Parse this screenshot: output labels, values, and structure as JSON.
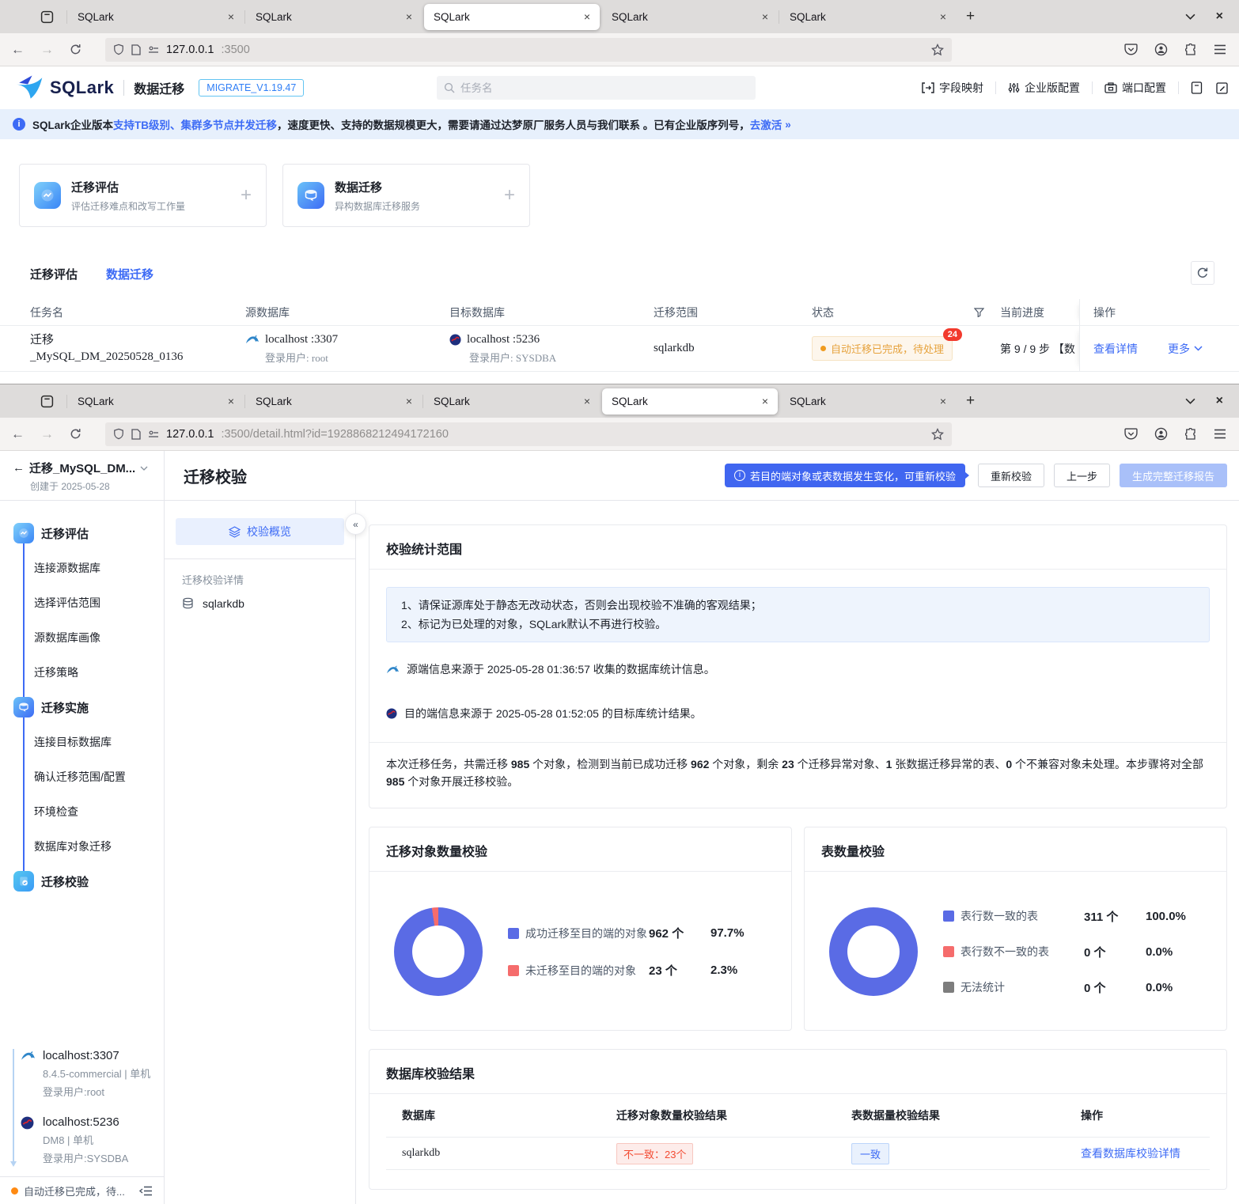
{
  "browser": {
    "tabs": [
      "SQLark",
      "SQLark",
      "SQLark",
      "SQLark",
      "SQLark"
    ],
    "window1": {
      "url_host": "127.0.0.1",
      "url_rest": ":3500"
    },
    "window2": {
      "url_host": "127.0.0.1",
      "url_rest": ":3500/detail.html?id=1928868212494172160"
    }
  },
  "app_header": {
    "brand": "SQLark",
    "product": "数据迁移",
    "version": "MIGRATE_V1.19.47",
    "search_placeholder": "任务名",
    "nav_field_mapping": "字段映射",
    "nav_enterprise": "企业版配置",
    "nav_port": "端口配置"
  },
  "banner": {
    "text_prefix": "SQLark企业版本",
    "link_capacity": "支持TB级别、集群多节点并发迁移",
    "text_middle": "，速度更快、支持的数据规模更大，需要请通过达梦原厂服务人员与我们联系 。已有企业版序列号，",
    "link_activate": "去激活",
    "arrow": "»"
  },
  "entry_cards": [
    {
      "title": "迁移评估",
      "desc": "评估迁移难点和改写工作量"
    },
    {
      "title": "数据迁移",
      "desc": "异构数据库迁移服务"
    }
  ],
  "task_list": {
    "tab_eval": "迁移评估",
    "tab_migrate": "数据迁移",
    "headers": {
      "name": "任务名",
      "source": "源数据库",
      "target": "目标数据库",
      "scope": "迁移范围",
      "status": "状态",
      "progress": "当前进度",
      "action": "操作"
    },
    "row": {
      "name_line1": "迁移",
      "name_line2": "_MySQL_DM_20250528_0136",
      "source_host": "localhost :3307",
      "source_user": "登录用户: root",
      "target_host": "localhost :5236",
      "target_user": "登录用户: SYSDBA",
      "scope": "sqlarkdb",
      "status": "自动迁移已完成，待处理",
      "status_count": "24",
      "progress": "第 9 / 9 步 【数",
      "action_view": "查看详情",
      "action_more": "更多"
    }
  },
  "detail": {
    "back_title": "迁移_MySQL_DM...",
    "created": "创建于 2025-05-28",
    "nav": {
      "eval": {
        "title": "迁移评估",
        "items": [
          "连接源数据库",
          "选择评估范围",
          "源数据库画像",
          "迁移策略"
        ]
      },
      "impl": {
        "title": "迁移实施",
        "items": [
          "连接目标数据库",
          "确认迁移范围/配置",
          "环境检查",
          "数据库对象迁移"
        ]
      },
      "verify": {
        "title": "迁移校验"
      }
    },
    "connections": [
      {
        "host": "localhost:3307",
        "meta": "8.4.5-commercial | 单机",
        "user": "登录用户:root"
      },
      {
        "host": "localhost:5236",
        "meta": "DM8 | 单机",
        "user": "登录用户:SYSDBA"
      }
    ],
    "status_bar": "自动迁移已完成，待...",
    "panel": {
      "overview": "校验概览",
      "detail_label": "迁移校验详情",
      "db": "sqlarkdb"
    },
    "page": {
      "title": "迁移校验",
      "tooltip": "若目的端对象或表数据发生变化，可重新校验",
      "btn_recheck": "重新校验",
      "btn_prev": "上一步",
      "btn_report": "生成完整迁移报告"
    },
    "scope": {
      "title": "校验统计范围",
      "notice1": "1、请保证源库处于静态无改动状态，否则会出现校验不准确的客观结果；",
      "notice2": "2、标记为已处理的对象，SQLark默认不再进行校验。",
      "source_info": "源端信息来源于 2025-05-28 01:36:57 收集的数据库统计信息。",
      "target_info": "目的端信息来源于 2025-05-28 01:52:05 的目标库统计结果。",
      "summary": {
        "p1": "本次迁移任务，共需迁移 ",
        "n1": "985",
        "p2": " 个对象，检测到当前已成功迁移 ",
        "n2": "962",
        "p3": " 个对象，剩余 ",
        "n3": "23",
        "p4": " 个迁移异常对象、",
        "n4": "1",
        "p5": " 张数据迁移异常的表、",
        "n5": "0",
        "p6": " 个不兼容对象未处理。本步骤将对全部 ",
        "n6": "985",
        "p7": " 个对象开展迁移校验。"
      }
    },
    "result": {
      "title": "数据库校验结果",
      "headers": [
        "数据库",
        "迁移对象数量校验结果",
        "表数据量校验结果",
        "操作"
      ],
      "row": {
        "db": "sqlarkdb",
        "object_result": "不一致：23个",
        "table_result": "一致",
        "action": "查看数据库校验详情"
      }
    }
  },
  "chart_data": [
    {
      "type": "pie",
      "title": "迁移对象数量校验",
      "legend_position": "right",
      "series": [
        {
          "name": "成功迁移至目的端的对象",
          "value": 962,
          "count_label": "962 个",
          "pct_label": "97.7%",
          "color": "#5A6BE5"
        },
        {
          "name": "未迁移至目的端的对象",
          "value": 23,
          "count_label": "23 个",
          "pct_label": "2.3%",
          "color": "#F56C6C"
        }
      ]
    },
    {
      "type": "pie",
      "title": "表数量校验",
      "legend_position": "right",
      "series": [
        {
          "name": "表行数一致的表",
          "value": 311,
          "count_label": "311 个",
          "pct_label": "100.0%",
          "color": "#5A6BE5"
        },
        {
          "name": "表行数不一致的表",
          "value": 0,
          "count_label": "0 个",
          "pct_label": "0.0%",
          "color": "#F56C6C"
        },
        {
          "name": "无法统计",
          "value": 0,
          "count_label": "0 个",
          "pct_label": "0.0%",
          "color": "#7D7D7D"
        }
      ]
    }
  ]
}
